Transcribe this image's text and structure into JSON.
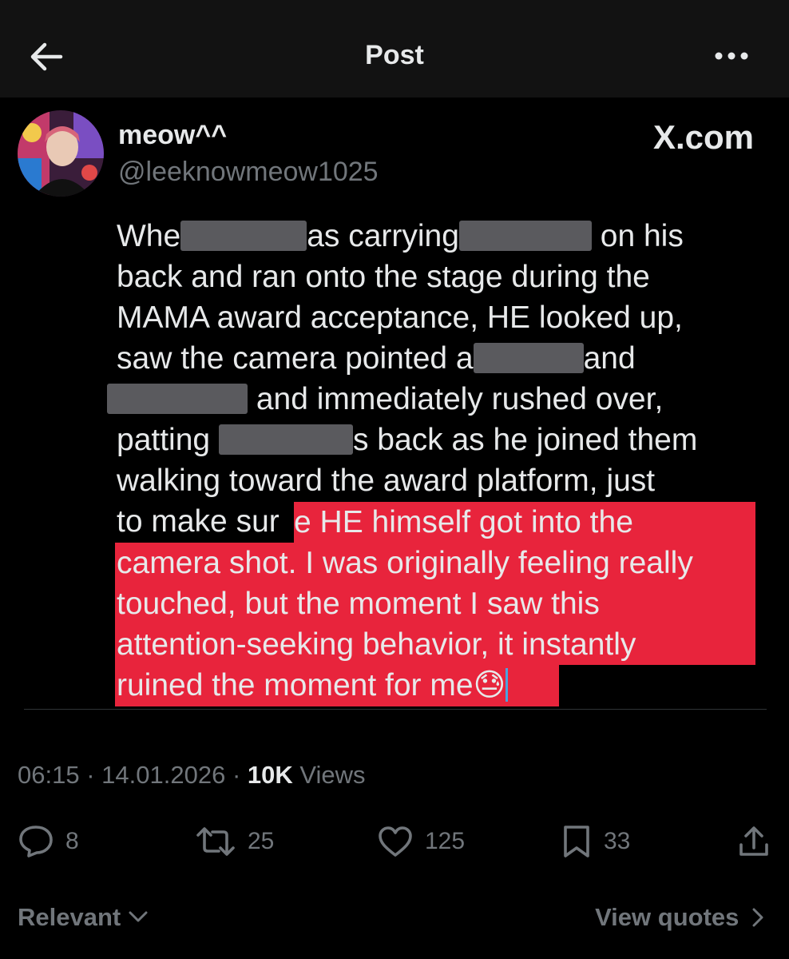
{
  "header": {
    "title": "Post",
    "back_icon": "arrow-left-icon",
    "more_icon": "more-horizontal-icon"
  },
  "author": {
    "display_name": "meow^^",
    "handle": "@leeknowmeow1025",
    "source": "X.com"
  },
  "post": {
    "lines": [
      [
        "Whe",
        "",
        "as carrying",
        "",
        " on his"
      ],
      [
        "back and ran onto the stage during the"
      ],
      [
        "MAMA award acceptance, HE looked up,"
      ],
      [
        "saw the camera pointed a",
        "",
        "and"
      ],
      [
        "",
        " and immediately rushed over,"
      ],
      [
        "patting ",
        "",
        "s back as he joined them"
      ],
      [
        "walking toward the award platform, just"
      ],
      [
        "to make sur"
      ]
    ],
    "highlight_lines": [
      "e HE himself got into the",
      "camera shot. I was originally feeling really",
      "touched, but the moment I saw this",
      "attention-seeking behavior, it instantly",
      "ruined the moment for me😓"
    ],
    "highlight_color": "#e8243c"
  },
  "meta": {
    "time": "06:15",
    "date": "14.01.2026",
    "views_count": "10K",
    "views_label": "Views"
  },
  "actions": {
    "replies": "8",
    "reposts": "25",
    "likes": "125",
    "bookmarks": "33"
  },
  "footer": {
    "sort_label": "Relevant",
    "quotes_label": "View quotes"
  }
}
